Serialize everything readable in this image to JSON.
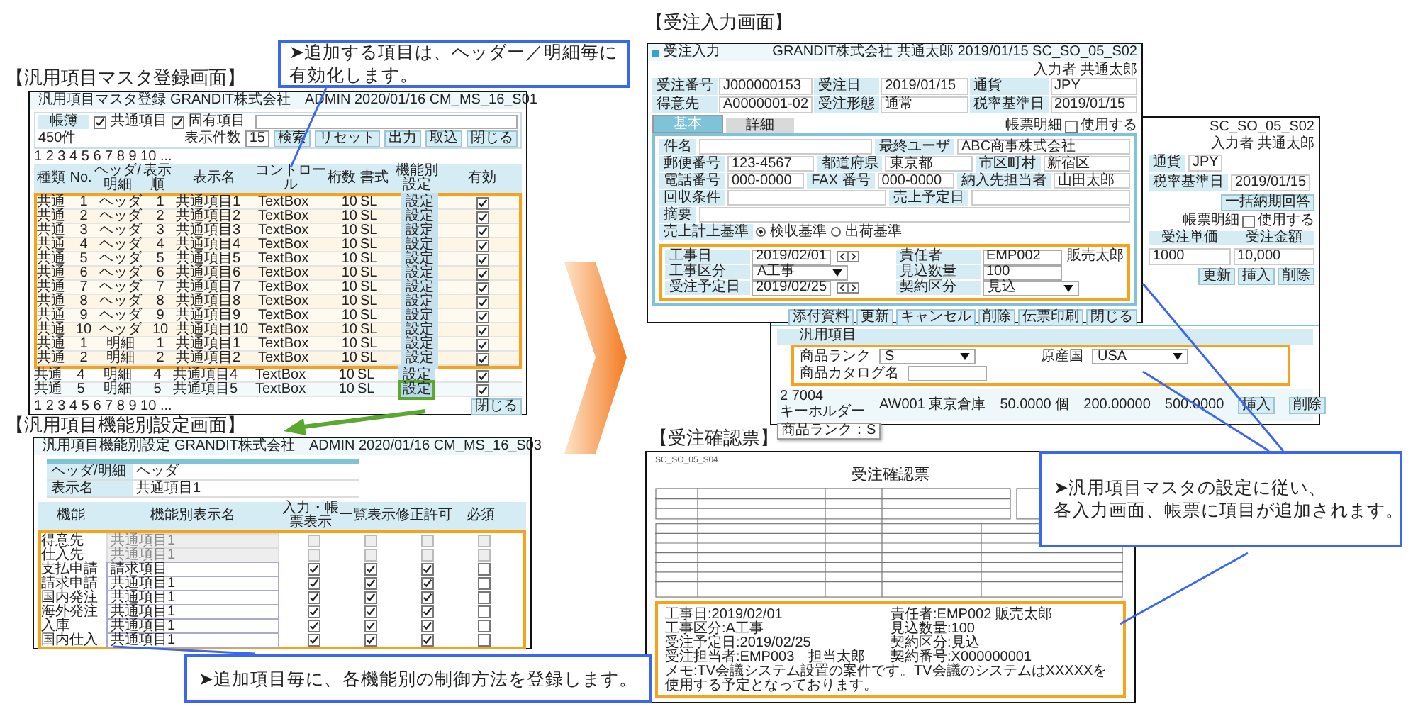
{
  "callouts": [
    {
      "lines": [
        "➤追加する項目は、ヘッダー／明細毎に",
        "有効化します。"
      ]
    },
    {
      "lines": [
        "➤追加項目毎に、各機能別の制御方法を登録します。"
      ]
    },
    {
      "lines": [
        "➤汎用項目マスタの設定に従い、",
        "各入力画面、帳票に項目が追加されます。"
      ]
    }
  ],
  "master": {
    "heading": "【汎用項目マスタ登録画面】",
    "title": "汎用項目マスタ登録",
    "info": "GRANDIT株式会社　ADMIN 2020/01/16 CM_MS_16_S01",
    "filter": {
      "label": "帳簿",
      "options": [
        {
          "label": "共通項目",
          "checked": true
        },
        {
          "label": "固有項目",
          "checked": true
        }
      ]
    },
    "count": "450件",
    "page_size_label": "表示件数",
    "page_size": "15",
    "buttons": [
      "検索",
      "リセット",
      "出力",
      "取込",
      "閉じる"
    ],
    "pager_top": "1 2 3 4 5 6 7 8 9 10 ...",
    "pager_bottom": "1 2 3 4 5 6 7 8 9 10 ...",
    "columns": [
      "種類",
      "No.",
      "ヘッダ/明細",
      "表示順",
      "表示名",
      "コントロール",
      "桁数",
      "書式",
      "機能別設定",
      "有効"
    ],
    "rows": [
      {
        "type": "共通",
        "no": "1",
        "part": "ヘッダ",
        "order": "1",
        "name": "共通項目1",
        "control": "TextBox",
        "digits": "10",
        "format": "SL",
        "setting": "設定",
        "enabled": true,
        "highlighted": true,
        "marked": false
      },
      {
        "type": "共通",
        "no": "2",
        "part": "ヘッダ",
        "order": "2",
        "name": "共通項目2",
        "control": "TextBox",
        "digits": "10",
        "format": "SL",
        "setting": "設定",
        "enabled": true,
        "highlighted": true,
        "marked": false
      },
      {
        "type": "共通",
        "no": "3",
        "part": "ヘッダ",
        "order": "3",
        "name": "共通項目3",
        "control": "TextBox",
        "digits": "10",
        "format": "SL",
        "setting": "設定",
        "enabled": true,
        "highlighted": true,
        "marked": false
      },
      {
        "type": "共通",
        "no": "4",
        "part": "ヘッダ",
        "order": "4",
        "name": "共通項目4",
        "control": "TextBox",
        "digits": "10",
        "format": "SL",
        "setting": "設定",
        "enabled": true,
        "highlighted": true,
        "marked": false
      },
      {
        "type": "共通",
        "no": "5",
        "part": "ヘッダ",
        "order": "5",
        "name": "共通項目5",
        "control": "TextBox",
        "digits": "10",
        "format": "SL",
        "setting": "設定",
        "enabled": true,
        "highlighted": true,
        "marked": false
      },
      {
        "type": "共通",
        "no": "6",
        "part": "ヘッダ",
        "order": "6",
        "name": "共通項目6",
        "control": "TextBox",
        "digits": "10",
        "format": "SL",
        "setting": "設定",
        "enabled": true,
        "highlighted": true,
        "marked": false
      },
      {
        "type": "共通",
        "no": "7",
        "part": "ヘッダ",
        "order": "7",
        "name": "共通項目7",
        "control": "TextBox",
        "digits": "10",
        "format": "SL",
        "setting": "設定",
        "enabled": true,
        "highlighted": true,
        "marked": false
      },
      {
        "type": "共通",
        "no": "8",
        "part": "ヘッダ",
        "order": "8",
        "name": "共通項目8",
        "control": "TextBox",
        "digits": "10",
        "format": "SL",
        "setting": "設定",
        "enabled": true,
        "highlighted": true,
        "marked": false
      },
      {
        "type": "共通",
        "no": "9",
        "part": "ヘッダ",
        "order": "9",
        "name": "共通項目9",
        "control": "TextBox",
        "digits": "10",
        "format": "SL",
        "setting": "設定",
        "enabled": true,
        "highlighted": true,
        "marked": false
      },
      {
        "type": "共通",
        "no": "10",
        "part": "ヘッダ",
        "order": "10",
        "name": "共通項目10",
        "control": "TextBox",
        "digits": "10",
        "format": "SL",
        "setting": "設定",
        "enabled": true,
        "highlighted": true,
        "marked": false
      },
      {
        "type": "共通",
        "no": "1",
        "part": "明細",
        "order": "1",
        "name": "共通項目1",
        "control": "TextBox",
        "digits": "10",
        "format": "SL",
        "setting": "設定",
        "enabled": true,
        "highlighted": true,
        "marked": false
      },
      {
        "type": "共通",
        "no": "2",
        "part": "明細",
        "order": "2",
        "name": "共通項目2",
        "control": "TextBox",
        "digits": "10",
        "format": "SL",
        "setting": "設定",
        "enabled": true,
        "highlighted": true,
        "marked": false
      },
      {
        "type": "共通",
        "no": "4",
        "part": "明細",
        "order": "4",
        "name": "共通項目4",
        "control": "TextBox",
        "digits": "10",
        "format": "SL",
        "setting": "設定",
        "enabled": true,
        "highlighted": false,
        "marked": false
      },
      {
        "type": "共通",
        "no": "5",
        "part": "明細",
        "order": "5",
        "name": "共通項目5",
        "control": "TextBox",
        "digits": "10",
        "format": "SL",
        "setting": "設定",
        "enabled": true,
        "highlighted": false,
        "marked": true
      }
    ],
    "close_button": "閉じる"
  },
  "func": {
    "heading": "【汎用項目機能別設定画面】",
    "title": "汎用項目機能別設定",
    "info": "GRANDIT株式会社　ADMIN 2020/01/16 CM_MS_16_S03",
    "fields": [
      {
        "label": "ヘッダ/明細",
        "value": "ヘッダ"
      },
      {
        "label": "表示名",
        "value": "共通項目1"
      }
    ],
    "columns": [
      "機能",
      "機能別表示名",
      "入力・帳票表示",
      "一覧表示",
      "修正許可",
      "必須"
    ],
    "rows": [
      {
        "function": "得意先",
        "display_name": "共通項目1",
        "disabled": true,
        "input_display": false,
        "list_display": false,
        "editable": false,
        "required": false
      },
      {
        "function": "仕入先",
        "display_name": "共通項目1",
        "disabled": true,
        "input_display": false,
        "list_display": false,
        "editable": false,
        "required": false
      },
      {
        "function": "支払申請",
        "display_name": "請求項目",
        "disabled": false,
        "input_display": true,
        "list_display": true,
        "editable": true,
        "required": false
      },
      {
        "function": "請求申請",
        "display_name": "共通項目1",
        "disabled": false,
        "input_display": true,
        "list_display": true,
        "editable": true,
        "required": false
      },
      {
        "function": "国内発注",
        "display_name": "共通項目1",
        "disabled": false,
        "input_display": true,
        "list_display": true,
        "editable": true,
        "required": false
      },
      {
        "function": "海外発注",
        "display_name": "共通項目1",
        "disabled": false,
        "input_display": true,
        "list_display": true,
        "editable": true,
        "required": false
      },
      {
        "function": "入庫",
        "display_name": "共通項目1",
        "disabled": false,
        "input_display": true,
        "list_display": true,
        "editable": true,
        "required": false
      },
      {
        "function": "国内仕入",
        "display_name": "共通項目1",
        "disabled": false,
        "input_display": true,
        "list_display": true,
        "editable": true,
        "required": false
      }
    ]
  },
  "order": {
    "heading": "【受注入力画面】",
    "title": "受注入力",
    "info": "GRANDIT株式会社 共通太郎 2019/01/15 SC_SO_05_S02",
    "user": "入力者 共通太郎",
    "header_fields": [
      {
        "label": "受注番号",
        "value": "J000000153"
      },
      {
        "label": "受注日",
        "value": "2019/01/15"
      },
      {
        "label": "通貨",
        "value": "JPY"
      },
      {
        "label": "得意先",
        "value": "A0000001-02"
      },
      {
        "label": "受注形態",
        "value": "通常"
      },
      {
        "label": "税率基準日",
        "value": "2019/01/15"
      }
    ],
    "tabs": [
      {
        "label": "基本",
        "selected": true
      },
      {
        "label": "詳細",
        "selected": false
      }
    ],
    "print_detail": {
      "label": "帳票明細",
      "option": "使用する",
      "checked": false
    },
    "form_rows": [
      [
        {
          "label": "件名"
        },
        {
          "label": "最終ユーザ",
          "value": "ABC商事株式会社"
        }
      ],
      [
        {
          "label": "郵便番号",
          "value": "123-4567"
        },
        {
          "label": "都道府県",
          "value": "東京都"
        },
        {
          "label": "市区町村",
          "value": "新宿区"
        }
      ],
      [
        {
          "label": "電話番号",
          "value": "000-0000"
        },
        {
          "label": "FAX 番号",
          "value": "000-0000"
        },
        {
          "label": "納入先担当者",
          "value": "山田太郎"
        }
      ],
      [
        {
          "label": "回収条件"
        },
        {
          "label": "売上予定日"
        }
      ],
      [
        {
          "label": "摘要"
        }
      ],
      [
        {
          "label": "売上計上基準",
          "options": [
            {
              "label": "検収基準",
              "selected": true
            },
            {
              "label": "出荷基準",
              "selected": false
            }
          ]
        }
      ]
    ],
    "generic_fields": [
      {
        "label": "工事日",
        "value": "2019/02/01",
        "kind": "date"
      },
      {
        "label": "責任者",
        "value": "EMP002",
        "note": "販売太郎",
        "kind": "text"
      },
      {
        "label": "工事区分",
        "value": "A工事",
        "kind": "select"
      },
      {
        "label": "見込数量",
        "value": "100",
        "kind": "text"
      },
      {
        "label": "受注予定日",
        "value": "2019/02/25",
        "kind": "date"
      },
      {
        "label": "契約区分",
        "value": "見込",
        "kind": "select"
      }
    ],
    "buttons": [
      "添付資料",
      "更新",
      "キャンセル",
      "削除",
      "伝票印刷",
      "閉じる"
    ]
  },
  "order_back": {
    "info": "SC_SO_05_S02",
    "user": "入力者 共通太郎",
    "fields": [
      {
        "label": "通貨",
        "value": "JPY"
      },
      {
        "label": "税率基準日",
        "value": "2019/01/15"
      }
    ],
    "button": "一括納期回答",
    "print_detail": {
      "label": "帳票明細",
      "option": "使用する",
      "checked": false
    },
    "columns": [
      "受注単価",
      "受注金額"
    ],
    "values": [
      "1000",
      "10,000"
    ],
    "actions": [
      "更新",
      "挿入",
      "削除"
    ],
    "generic_title": "汎用項目",
    "generic_fields": [
      {
        "label": "商品ランク",
        "value": "S",
        "kind": "select"
      },
      {
        "label": "原産国",
        "value": "USA",
        "kind": "select"
      },
      {
        "label": "商品カタログ名",
        "kind": "text"
      }
    ],
    "line": {
      "no": "2",
      "code": "7004",
      "name": "キーホルダー",
      "warehouse": "AW001 東京倉庫",
      "quantity": "50.0000 個",
      "price": "200.00000",
      "amount": "500.0000"
    },
    "line_actions": [
      "挿入",
      "削除"
    ],
    "tooltip": "商品ランク：S"
  },
  "confirmation": {
    "heading": "【受注確認票】",
    "code": "SC_SO_05_S04",
    "title": "受注確認票",
    "left": [
      "工事日:2019/02/01",
      "工事区分:A工事",
      "受注予定日:2019/02/25",
      "受注担当者:EMP003　担当太郎"
    ],
    "right": [
      "責任者:EMP002 販売太郎",
      "見込数量:100",
      "契約区分:見込",
      "契約番号:X000000001"
    ],
    "memo": "メモ:TV会議システム設置の案件です。TV会議のシステムはXXXXXを使用する予定となっております。"
  }
}
